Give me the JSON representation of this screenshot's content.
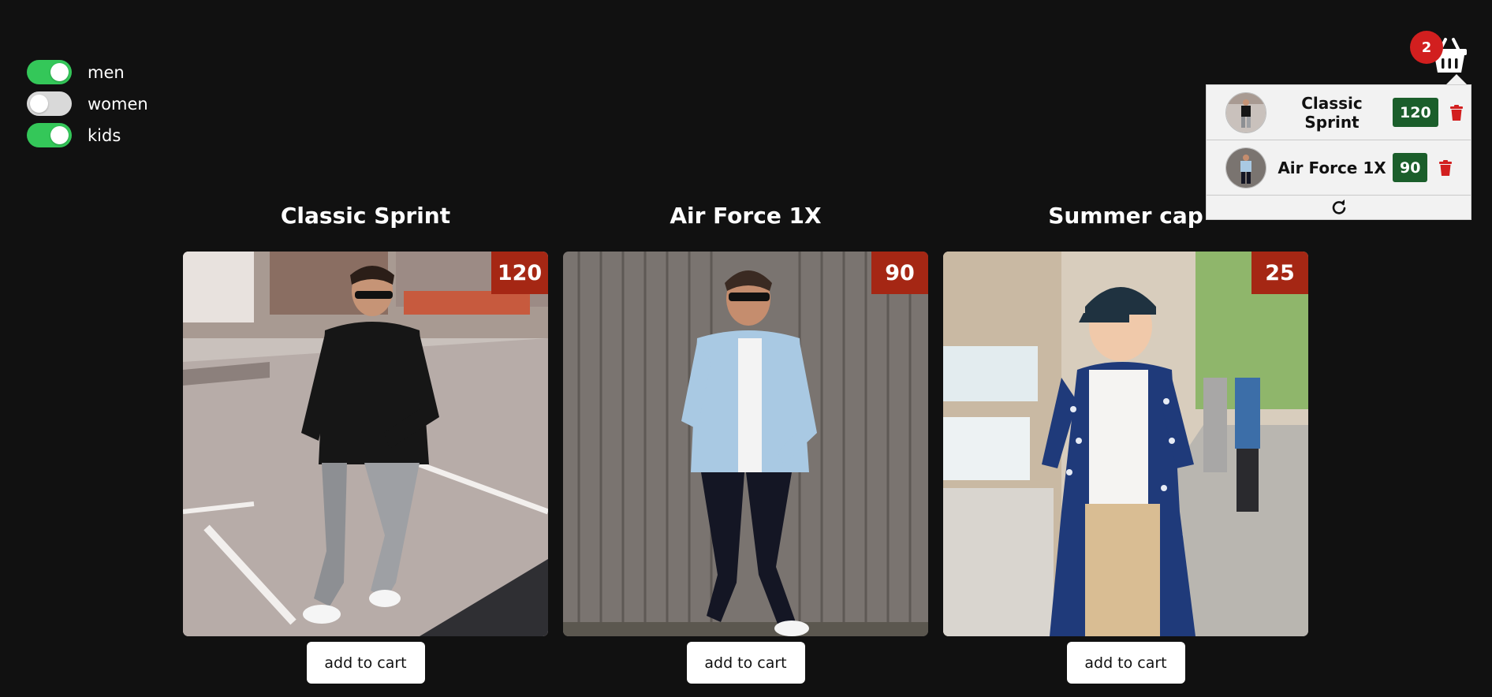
{
  "filters": [
    {
      "label": "men",
      "checked": true
    },
    {
      "label": "women",
      "checked": false
    },
    {
      "label": "kids",
      "checked": true
    }
  ],
  "products": [
    {
      "name": "Classic Sprint",
      "price": "120",
      "button": "add to cart"
    },
    {
      "name": "Air Force 1X",
      "price": "90",
      "button": "add to cart"
    },
    {
      "name": "Summer cap",
      "price": "25",
      "button": "add to cart"
    }
  ],
  "cart": {
    "count": "2",
    "items": [
      {
        "name": "Classic Sprint",
        "price": "120"
      },
      {
        "name": "Air Force 1X",
        "price": "90"
      }
    ]
  },
  "colors": {
    "background": "#111111",
    "toggle_on": "#34c759",
    "toggle_off": "#d9d9d9",
    "price_badge": "#a52714",
    "cart_price": "#1b5e2b",
    "cart_count": "#d21f1f",
    "delete_icon": "#d21f1f"
  },
  "icons": {
    "cart": "shopping-basket-icon",
    "delete": "trash-icon",
    "refresh": "refresh-icon"
  }
}
